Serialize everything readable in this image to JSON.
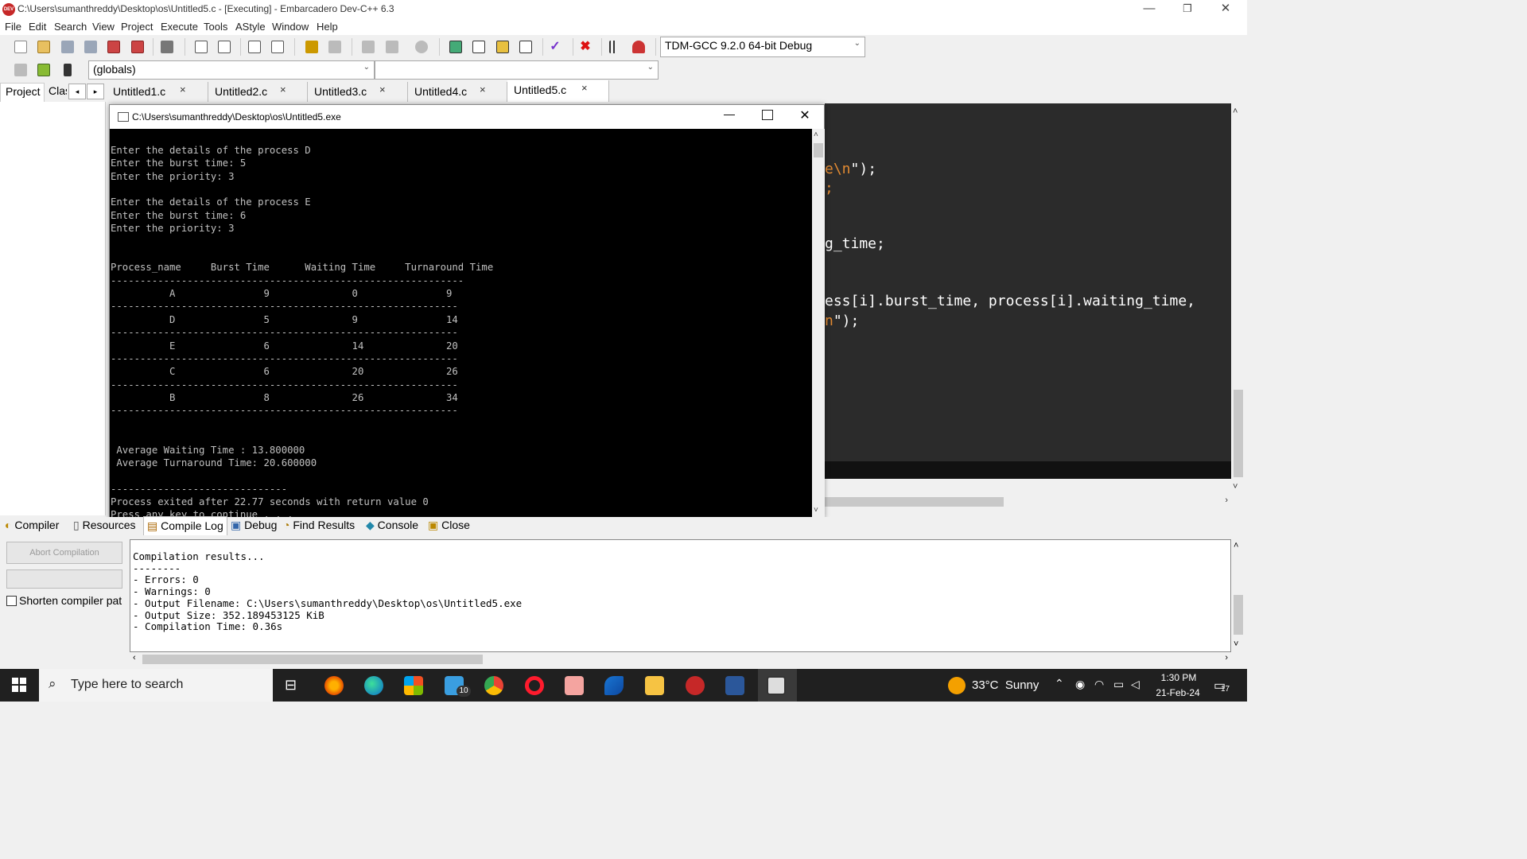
{
  "window": {
    "app_icon_text": "DEV",
    "title": "C:\\Users\\sumanthreddy\\Desktop\\os\\Untitled5.c - [Executing] - Embarcadero Dev-C++ 6.3",
    "minimize": "—",
    "restore": "❐",
    "close": "✕"
  },
  "menu": [
    "File",
    "Edit",
    "Search",
    "View",
    "Project",
    "Execute",
    "Tools",
    "AStyle",
    "Window",
    "Help"
  ],
  "toolbar": {
    "compiler_select": "TDM-GCC 9.2.0 64-bit Debug",
    "scope_select": "(globals)",
    "symbol_select": ""
  },
  "left_tabs": {
    "project": "Project",
    "classes": "Clas"
  },
  "file_tabs": [
    "Untitled1.c",
    "Untitled2.c",
    "Untitled3.c",
    "Untitled4.c",
    "Untitled5.c"
  ],
  "editor_lines": [
    {
      "plain": "",
      "orange": "e\\n",
      "tail": "\");"
    },
    {
      "plain": "",
      "orange": ";",
      "tail": ""
    },
    {
      "plain": "g_time;",
      "orange": "",
      "tail": ""
    },
    {
      "plain": "ess[i].burst_time, process[i].waiting_time,",
      "orange": "",
      "tail": ""
    },
    {
      "plain": "",
      "orange": "n",
      "tail": "\");"
    }
  ],
  "console": {
    "title": "C:\\Users\\sumanthreddy\\Desktop\\os\\Untitled5.exe",
    "lines": [
      "Enter the details of the process D",
      "Enter the burst time: 5",
      "Enter the priority: 3",
      "",
      "Enter the details of the process E",
      "Enter the burst time: 6",
      "Enter the priority: 3",
      "",
      "",
      "Process_name     Burst Time      Waiting Time     Turnaround Time",
      "------------------------------------------------------------",
      "          A               9              0               9",
      "-----------------------------------------------------------",
      "          D               5              9               14",
      "-----------------------------------------------------------",
      "          E               6              14              20",
      "-----------------------------------------------------------",
      "          C               6              20              26",
      "-----------------------------------------------------------",
      "          B               8              26              34",
      "-----------------------------------------------------------",
      "",
      "",
      " Average Waiting Time : 13.800000",
      " Average Turnaround Time: 20.600000",
      "",
      "------------------------------",
      "Process exited after 22.77 seconds with return value 0",
      "Press any key to continue . . . _"
    ]
  },
  "bottom_tabs": [
    "Compiler",
    "Resources",
    "Compile Log",
    "Debug",
    "Find Results",
    "Console",
    "Close"
  ],
  "compile_panel": {
    "abort_button": "Abort Compilation",
    "shorten_label": "Shorten compiler pat",
    "log_lines": [
      "Compilation results...",
      "--------",
      "- Errors: 0",
      "- Warnings: 0",
      "- Output Filename: C:\\Users\\sumanthreddy\\Desktop\\os\\Untitled5.exe",
      "- Output Size: 352.189453125 KiB",
      "- Compilation Time: 0.36s"
    ]
  },
  "taskbar": {
    "search_placeholder": "Type here to search",
    "mail_badge": "10",
    "weather": "33°C  Sunny",
    "time": "1:30 PM",
    "date": "21-Feb-24",
    "notification_count": "17"
  }
}
